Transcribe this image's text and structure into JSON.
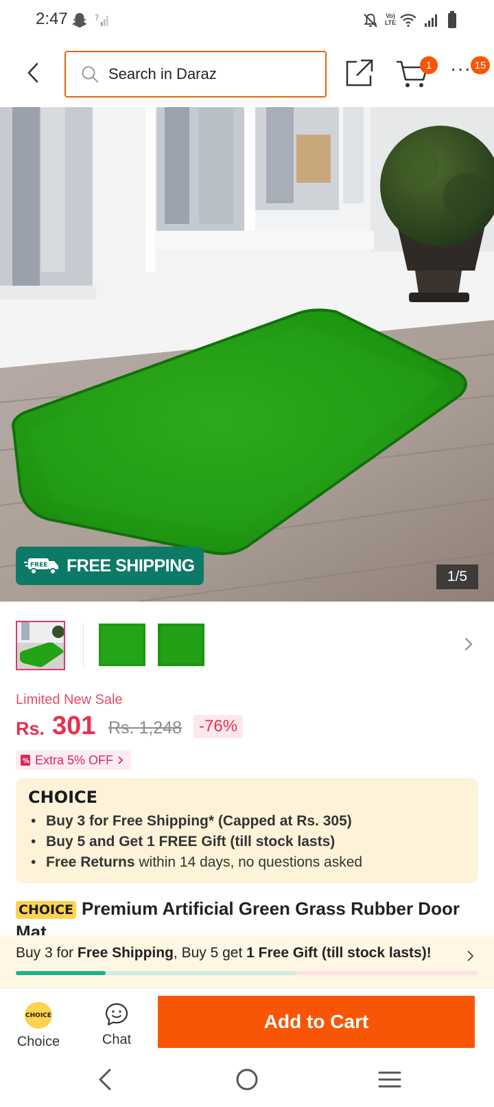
{
  "status_bar": {
    "time": "2:47",
    "network_label": "Vo) LTE"
  },
  "header": {
    "search_placeholder": "Search in Daraz",
    "cart_count": "1",
    "more_count": "15"
  },
  "gallery": {
    "badge_free_text": "FREE",
    "badge_label": "FREE SHIPPING",
    "counter": "1/5",
    "thumbnails_count": 3,
    "selected_thumbnail": 1
  },
  "pricing": {
    "sale_label": "Limited New Sale",
    "currency": "Rs.",
    "price": "301",
    "original_price": "Rs. 1,248",
    "discount": "-76%",
    "extra_off": "Extra 5% OFF"
  },
  "choice_box": {
    "logo": "CHOICE",
    "items": [
      {
        "bold": "Buy 3 for  Free Shipping* (Capped at Rs. 305)",
        "rest": ""
      },
      {
        "bold": "Buy 5 and Get 1 FREE Gift (till stock lasts)",
        "rest": ""
      },
      {
        "bold": "Free Returns",
        "rest": " within 14 days, no questions asked"
      }
    ]
  },
  "product": {
    "tag": "CHOICE",
    "title": "Premium Artificial Green Grass Rubber Door Mat"
  },
  "promo_bar": {
    "t1": "Buy 3 for ",
    "b1": "Free Shipping",
    "t2": ", Buy 5 get ",
    "b2": "1 Free Gift (till stock lasts)!",
    "progress": 0.32
  },
  "action_bar": {
    "choice_label": "Choice",
    "choice_coin": "CHOICE",
    "chat_label": "Chat",
    "add_to_cart": "Add to Cart"
  },
  "colors": {
    "brand_orange": "#f85606",
    "search_border": "#e2650e",
    "price_red": "#e8304d",
    "free_shipping_green": "#0c7a66",
    "choice_yellow": "#fcd34d",
    "choice_bg": "#fef3d9"
  }
}
